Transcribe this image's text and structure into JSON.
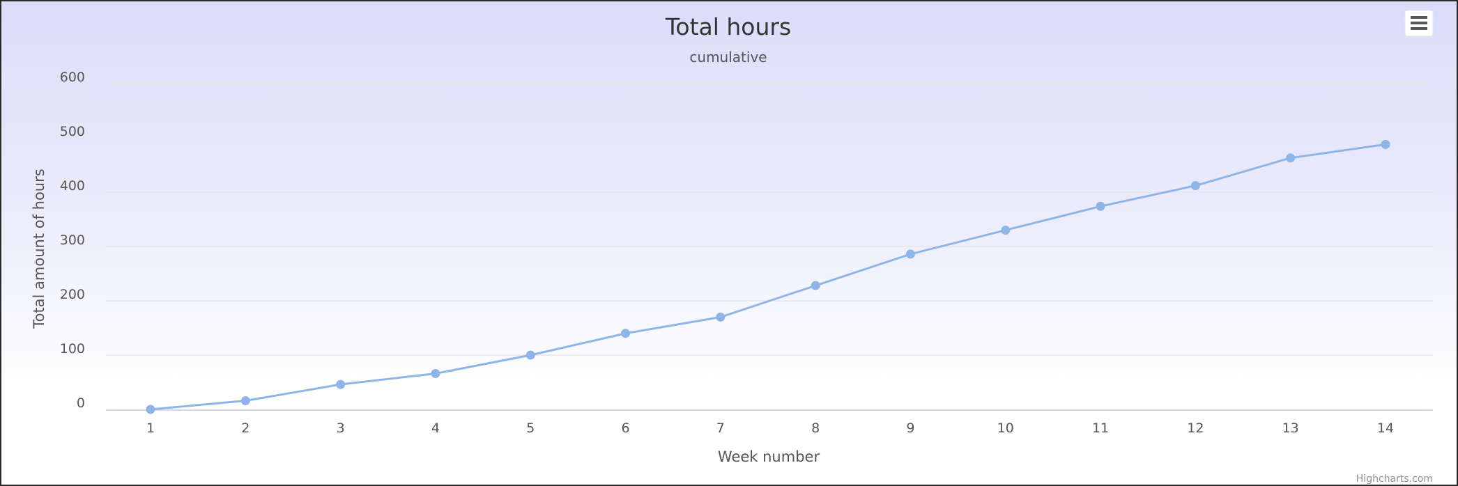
{
  "chart_data": {
    "type": "line",
    "title": "Total hours",
    "subtitle": "cumulative",
    "xlabel": "Week number",
    "ylabel": "Total amount of hours",
    "categories": [
      "1",
      "2",
      "3",
      "4",
      "5",
      "6",
      "7",
      "8",
      "9",
      "10",
      "11",
      "12",
      "13",
      "14"
    ],
    "series": [
      {
        "values": [
          0,
          16,
          46,
          66,
          100,
          140,
          170,
          228,
          286,
          330,
          374,
          412,
          463,
          488
        ],
        "color": "#8db5e8"
      }
    ],
    "y_ticks": [
      "0",
      "100",
      "200",
      "300",
      "400",
      "500",
      "600"
    ],
    "ylim": [
      0,
      600
    ],
    "grid": true,
    "legend": "none"
  },
  "credits": "Highcharts.com",
  "menu_icon": "hamburger-menu-icon"
}
